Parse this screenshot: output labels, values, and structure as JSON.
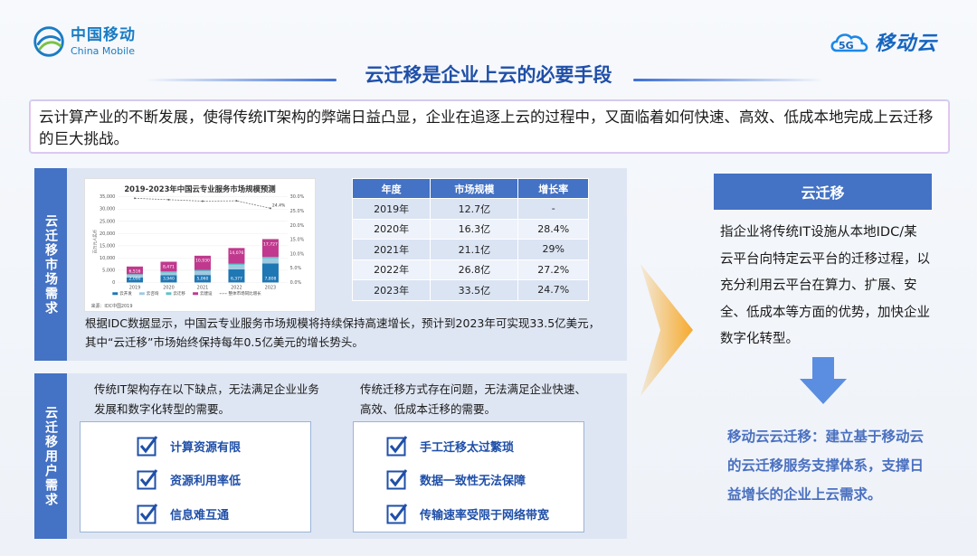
{
  "header": {
    "brand_cn": "中国移动",
    "brand_en": "China Mobile",
    "cloud_brand": "移动云",
    "cloud_brand_badge": "5G",
    "title": "云迁移是企业上云的必要手段"
  },
  "intro": "云计算产业的不断发展，使得传统IT架构的弊端日益凸显，企业在追逐上云的过程中，又面临着如何快速、高效、低成本地完成上云迁移的巨大挑战。",
  "market": {
    "label": "云迁移市场需求",
    "chart_caption": "来源：IDC中国2019",
    "description": "根据IDC数据显示，中国云专业服务市场规模将持续保持高速增长，预计到2023年可实现33.5亿美元，其中“云迁移”市场始终保持每年0.5亿美元的增长势头。",
    "table": {
      "headers": [
        "年度",
        "市场规模",
        "增长率"
      ],
      "rows": [
        [
          "2019年",
          "12.7亿",
          "-"
        ],
        [
          "2020年",
          "16.3亿",
          "28.4%"
        ],
        [
          "2021年",
          "21.1亿",
          "29%"
        ],
        [
          "2022年",
          "26.8亿",
          "27.2%"
        ],
        [
          "2023年",
          "33.5亿",
          "24.7%"
        ]
      ]
    }
  },
  "chart_data": {
    "type": "bar",
    "title": "2019-2023年中国云专业服务市场规模预测",
    "categories": [
      "2019",
      "2020",
      "2021",
      "2022",
      "2023"
    ],
    "totals": [
      6516,
      8471,
      10930,
      14076,
      17727
    ],
    "series": [
      {
        "name": "云开发",
        "values": [
          2090,
          2940,
          3060,
          5377,
          7808
        ],
        "color": "#1f77b4"
      },
      {
        "name": "云咨询",
        "values": [
          900,
          1100,
          1500,
          1700,
          2000
        ],
        "color": "#9ecae1"
      },
      {
        "name": "云迁移",
        "values": [
          400,
          450,
          500,
          550,
          600
        ],
        "color": "#5ec2c9"
      },
      {
        "name": "云建设",
        "values": [
          3126,
          3981,
          5870,
          6449,
          7319
        ],
        "color": "#c0398e"
      }
    ],
    "bottom_labels": [
      "2,090",
      "3,940",
      "5,060",
      "6,377",
      "7,808"
    ],
    "rate_series": {
      "name": "整体市场同比增长",
      "values": [
        29.5,
        29.0,
        28.5,
        28.6,
        26.0
      ]
    },
    "rate_labels": [
      "",
      "",
      "",
      "",
      "24.4%"
    ],
    "y_ticks": [
      "0",
      "5,000",
      "10,000",
      "15,000",
      "20,000",
      "25,000",
      "30,000",
      "35,000"
    ],
    "y2_ticks": [
      "0.0%",
      "5.0%",
      "10.0%",
      "15.0%",
      "20.0%",
      "25.0%",
      "30.0%"
    ],
    "ylim": [
      0,
      35000
    ],
    "y2lim": [
      0,
      30
    ],
    "ylabel": "百万元人民币"
  },
  "user": {
    "label": "云迁移用户需求",
    "left_desc": "传统IT架构存在以下缺点，无法满足企业业务发展和数字化转型的需要。",
    "right_desc": "传统迁移方式存在问题，无法满足企业快速、高效、低成本迁移的需要。",
    "left_items": [
      "计算资源有限",
      "资源利用率低",
      "信息难互通"
    ],
    "right_items": [
      "手工迁移太过繁琐",
      "数据一致性无法保障",
      "传输速率受限于网络带宽"
    ]
  },
  "right": {
    "heading": "云迁移",
    "description": "指企业将传统IT设施从本地IDC/某云平台向特定云平台的迁移过程，以充分利用云平台在算力、扩展、安全、低成本等方面的优势，加快企业数字化转型。",
    "conclusion": "移动云云迁移：建立基于移动云的云迁移服务支撑体系，支撑日益增长的企业上云需求。"
  },
  "colors": {
    "accent": "#4472c4",
    "title": "#1f4fa8",
    "panel_bg": "#dfe6f3",
    "check": "#1f4fa8"
  }
}
